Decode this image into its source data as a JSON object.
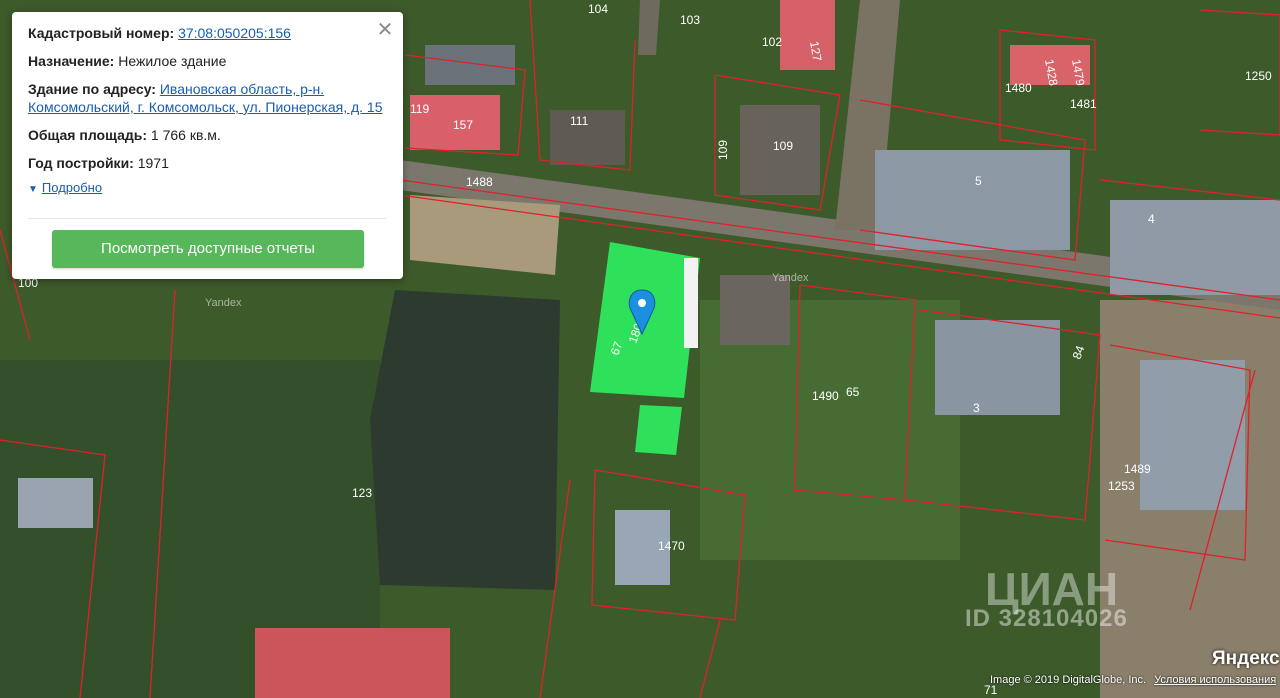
{
  "card": {
    "cadastral_label": "Кадастровый номер:",
    "cadastral_value": "37:08:050205:156",
    "purpose_label": "Назначение:",
    "purpose_value": "Нежилое здание",
    "address_label": "Здание по адресу:",
    "address_value": "Ивановская область, р-н. Комсомольский, г. Комсомольск, ул. Пионерская, д. 15",
    "area_label": "Общая площадь:",
    "area_value": "1 766 кв.м.",
    "year_label": "Год постройки:",
    "year_value": "1971",
    "details_link": "Подробно",
    "reports_button": "Посмотреть доступные отчеты",
    "close_icon": "close-icon"
  },
  "map": {
    "parcel_labels": [
      "104",
      "103",
      "102",
      "127",
      "1428",
      "1479",
      "1480",
      "1481",
      "1250",
      "119",
      "157",
      "111",
      "109",
      "109",
      "1488",
      "5",
      "4",
      "100",
      "123",
      "1490",
      "65",
      "3",
      "84",
      "1489",
      "1253",
      "1470",
      "67",
      "180",
      "71"
    ],
    "watermark_yandex": "Yandex",
    "watermark_cian": "ЦИАН",
    "watermark_id": "ID 328104026",
    "pin_icon": "location-pin-icon",
    "highlight_color": "#2ee05a",
    "boundary_color": "#e0202a"
  },
  "footer": {
    "attribution": "Image © 2019 DigitalGlobe, Inc.",
    "terms": "Условия использования",
    "logo": "Яндекс"
  }
}
